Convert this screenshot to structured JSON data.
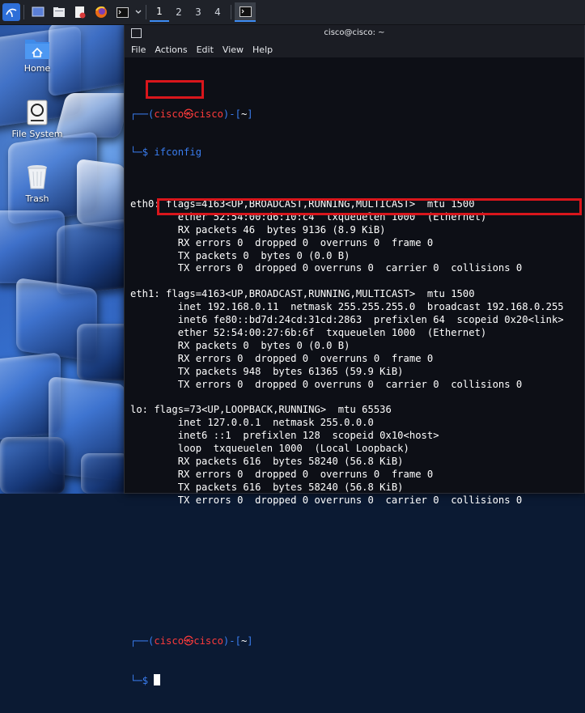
{
  "taskbar": {
    "workspaces": [
      "1",
      "2",
      "3",
      "4"
    ],
    "active_workspace": "1",
    "launchers": [
      "kali-menu-icon",
      "show-desktop-icon",
      "file-manager-icon",
      "text-editor-icon",
      "firefox-icon",
      "terminal-icon"
    ]
  },
  "desktop": {
    "icons": [
      {
        "label": "Home",
        "icon": "home-folder-icon"
      },
      {
        "label": "File System",
        "icon": "drive-icon"
      },
      {
        "label": "Trash",
        "icon": "trash-icon"
      }
    ]
  },
  "terminal": {
    "window_title": "cisco@cisco: ~",
    "menu": [
      "File",
      "Actions",
      "Edit",
      "View",
      "Help"
    ],
    "prompt_user": "cisco",
    "prompt_at": "㉿",
    "prompt_host": "cisco",
    "prompt_dir": "~",
    "command": "ifconfig",
    "output": [
      "eth0: flags=4163<UP,BROADCAST,RUNNING,MULTICAST>  mtu 1500",
      "        ether 52:54:00:d6:10:c4  txqueuelen 1000  (Ethernet)",
      "        RX packets 46  bytes 9136 (8.9 KiB)",
      "        RX errors 0  dropped 0  overruns 0  frame 0",
      "        TX packets 0  bytes 0 (0.0 B)",
      "        TX errors 0  dropped 0 overruns 0  carrier 0  collisions 0",
      "",
      "eth1: flags=4163<UP,BROADCAST,RUNNING,MULTICAST>  mtu 1500",
      "        inet 192.168.0.11  netmask 255.255.255.0  broadcast 192.168.0.255",
      "        inet6 fe80::bd7d:24cd:31cd:2863  prefixlen 64  scopeid 0x20<link>",
      "        ether 52:54:00:27:6b:6f  txqueuelen 1000  (Ethernet)",
      "        RX packets 0  bytes 0 (0.0 B)",
      "        RX errors 0  dropped 0  overruns 0  frame 0",
      "        TX packets 948  bytes 61365 (59.9 KiB)",
      "        TX errors 0  dropped 0 overruns 0  carrier 0  collisions 0",
      "",
      "lo: flags=73<UP,LOOPBACK,RUNNING>  mtu 65536",
      "        inet 127.0.0.1  netmask 255.0.0.0",
      "        inet6 ::1  prefixlen 128  scopeid 0x10<host>",
      "        loop  txqueuelen 1000  (Local Loopback)",
      "        RX packets 616  bytes 58240 (56.8 KiB)",
      "        RX errors 0  dropped 0  overruns 0  frame 0",
      "        TX packets 616  bytes 58240 (56.8 KiB)",
      "        TX errors 0  dropped 0 overruns 0  carrier 0  collisions 0"
    ],
    "prompt_symbol": "$"
  },
  "colors": {
    "prompt_blue": "#3a7df0",
    "highlight_red": "#d9161c",
    "terminal_bg": "#0d0f16"
  }
}
